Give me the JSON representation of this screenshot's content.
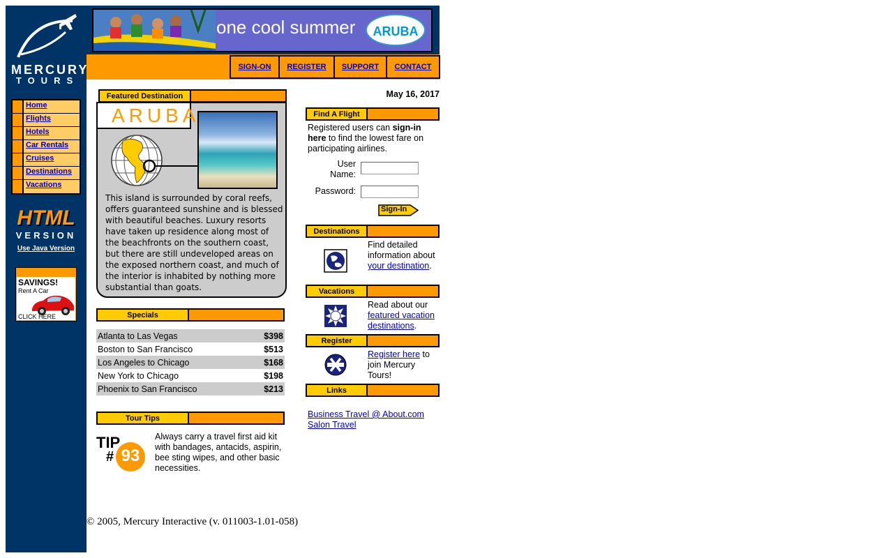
{
  "logo": {
    "line1": "MERCURY",
    "line2": "TOURS"
  },
  "sidebar": {
    "items": [
      {
        "label": "Home"
      },
      {
        "label": "Flights"
      },
      {
        "label": "Hotels"
      },
      {
        "label": "Car Rentals"
      },
      {
        "label": "Cruises"
      },
      {
        "label": "Destinations"
      },
      {
        "label": "Vacations"
      }
    ],
    "html_version": {
      "big": "HTML",
      "sub": "VERSION",
      "java_link": "Use Java Version"
    },
    "savings_ad": {
      "title": "SAVINGS!",
      "subtitle": "Rent A Car",
      "cta": "CLICK HERE"
    }
  },
  "banner": {
    "text": "one cool summer",
    "badge": "ARUBA"
  },
  "topnav": {
    "items": [
      {
        "label": "SIGN-ON"
      },
      {
        "label": "REGISTER"
      },
      {
        "label": "SUPPORT"
      },
      {
        "label": "CONTACT"
      }
    ]
  },
  "featured": {
    "header": "Featured Destination",
    "name": "ARUBA",
    "description": "This island is surrounded by coral reefs, offers guaranteed sunshine and is blessed with beautiful beaches. Luxury resorts have taken up residence along most of the beachfronts on the southern coast, but there are still undeveloped areas on the exposed northern coast, and much of the interior is inhabited by nothing more substantial than goats."
  },
  "specials": {
    "header": "Specials",
    "rows": [
      {
        "route": "Atlanta to Las Vegas",
        "price": "$398"
      },
      {
        "route": "Boston to San Francisco",
        "price": "$513"
      },
      {
        "route": "Los Angeles to Chicago",
        "price": "$168"
      },
      {
        "route": "New York to Chicago",
        "price": "$198"
      },
      {
        "route": "Phoenix to San Francisco",
        "price": "$213"
      }
    ]
  },
  "tour_tips": {
    "header": "Tour Tips",
    "tip_word": "TIP",
    "tip_hash": "#",
    "tip_number": "93",
    "text": "Always carry a travel first aid kit with bandages, antacids, aspirin, bee sting wipes, and other basic necessities."
  },
  "date": "May 16, 2017",
  "find_flight": {
    "header": "Find A Flight",
    "intro_pre": "Registered users can ",
    "intro_bold": "sign-in here",
    "intro_post": " to find the lowest fare on participating airlines.",
    "username_label": "User Name:",
    "password_label": "Password:",
    "username_value": "",
    "password_value": "",
    "signin_label": "Sign-In"
  },
  "destinations": {
    "header": "Destinations",
    "text_pre": "Find detailed information about ",
    "link": "your destination",
    "text_post": "."
  },
  "vacations": {
    "header": "Vacations",
    "text_pre": "Read about our ",
    "link": "featured vacation destinations",
    "text_post": "."
  },
  "register": {
    "header": "Register",
    "link": "Register here",
    "text_post": " to join Mercury Tours!"
  },
  "links": {
    "header": "Links",
    "items": [
      {
        "label": "Business Travel @ About.com"
      },
      {
        "label": "Salon Travel"
      }
    ]
  },
  "footer": "© 2005, Mercury Interactive (v. 011003-1.01-058)",
  "colors": {
    "navy": "#003366",
    "orange": "#ff9900",
    "yellow": "#ffcc00",
    "light_orange": "#ffcc66",
    "gray": "#cccccc",
    "link": "#0000cc"
  }
}
